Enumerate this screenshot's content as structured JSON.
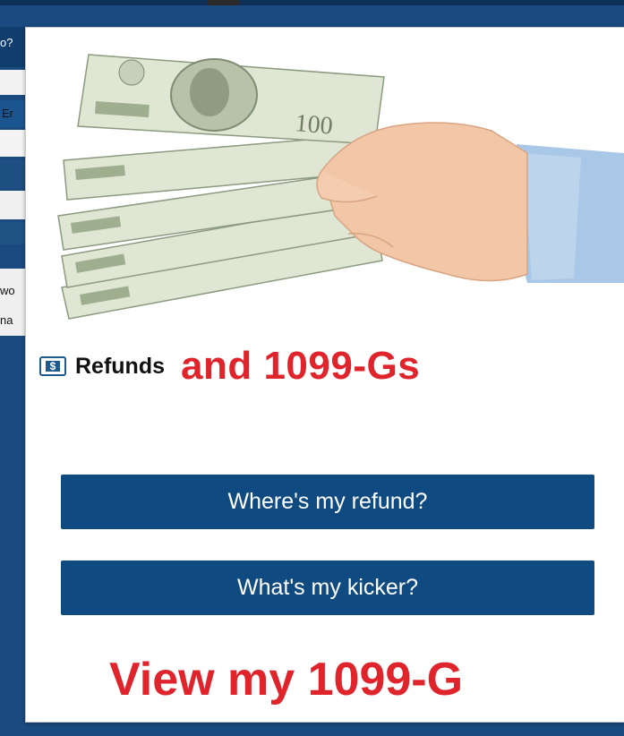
{
  "background_page": {
    "fragments": [
      "o?",
      "Er",
      "wo",
      "na"
    ]
  },
  "modal": {
    "hero_image": "hand-holding-money",
    "heading": {
      "icon": "dollar-icon",
      "icon_glyph": "$",
      "refunds_label": "Refunds",
      "tagline": "and 1099-Gs"
    },
    "buttons": {
      "refund": "Where's my refund?",
      "kicker": "What's my kicker?"
    },
    "link": "View my 1099-G"
  },
  "colors": {
    "accent_red": "#e0242c",
    "button_blue": "#0f4a80",
    "page_blue": "#1a4a80"
  }
}
